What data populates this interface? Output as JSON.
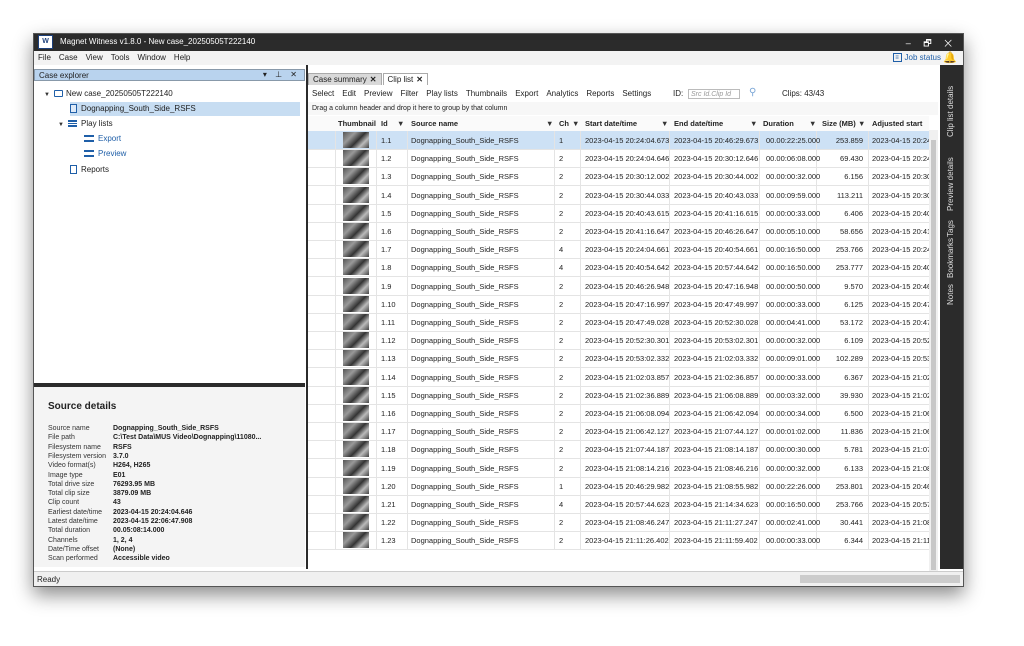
{
  "window": {
    "title": "Magnet Witness v1.8.0 - New case_20250505T222140",
    "logo": "W",
    "controls": "– 🗗 ✕"
  },
  "menu": [
    "File",
    "Case",
    "View",
    "Tools",
    "Window",
    "Help"
  ],
  "job_status": "Job status",
  "left_pane": {
    "title": "Case explorer",
    "controls": "▾ ⊥ ✕",
    "tree": {
      "case": "New case_20250505T222140",
      "source": "Dognapping_South_Side_RSFS",
      "play_lists": "Play lists",
      "export": "Export",
      "preview": "Preview",
      "reports": "Reports"
    }
  },
  "source_details": {
    "title": "Source details",
    "rows": [
      {
        "k": "Source name",
        "v": "Dognapping_South_Side_RSFS"
      },
      {
        "k": "File path",
        "v": "C:\\Test Data\\MUS Video\\Dognapping\\11080..."
      },
      {
        "k": "Filesystem name",
        "v": "RSFS"
      },
      {
        "k": "Filesystem version",
        "v": "3.7.0"
      },
      {
        "k": "Video format(s)",
        "v": "H264, H265"
      },
      {
        "k": "Image type",
        "v": "E01"
      },
      {
        "k": "Total drive size",
        "v": "76293.95 MB"
      },
      {
        "k": "Total clip size",
        "v": "3879.09 MB"
      },
      {
        "k": "Clip count",
        "v": "43"
      },
      {
        "k": "Earliest date/time",
        "v": "2023-04-15 20:24:04.646"
      },
      {
        "k": "Latest date/time",
        "v": "2023-04-15 22:06:47.908"
      },
      {
        "k": "Total duration",
        "v": "00.05:08:14.000"
      },
      {
        "k": "Channels",
        "v": "1, 2, 4"
      },
      {
        "k": "Date/Time offset",
        "v": "(None)"
      },
      {
        "k": "Scan performed",
        "v": "Accessible video"
      }
    ]
  },
  "tabs": [
    {
      "label": "Case summary"
    },
    {
      "label": "Clip list"
    }
  ],
  "toolbar": [
    "Select",
    "Edit",
    "Preview",
    "Filter",
    "Play lists",
    "Thumbnails",
    "Export",
    "Analytics",
    "Reports",
    "Settings"
  ],
  "id_filter": {
    "label": "ID:",
    "placeholder": "Src Id.Clip Id"
  },
  "clips_count": "Clips: 43/43",
  "group_hint": "Drag a column header and drop it here to group by that column",
  "columns": [
    "Thumbnail",
    "Id",
    "Source name",
    "Ch",
    "Start date/time",
    "End date/time",
    "Duration",
    "Size (MB)",
    "Adjusted start"
  ],
  "rows": [
    {
      "id": "1.1",
      "src": "Dognapping_South_Side_RSFS",
      "ch": "1",
      "start": "2023-04-15 20:24:04.673",
      "end": "2023-04-15 20:46:29.673",
      "dur": "00.00:22:25.000",
      "size": "253.859",
      "adj": "2023-04-15 20:24"
    },
    {
      "id": "1.2",
      "src": "Dognapping_South_Side_RSFS",
      "ch": "2",
      "start": "2023-04-15 20:24:04.646",
      "end": "2023-04-15 20:30:12.646",
      "dur": "00.00:06:08.000",
      "size": "69.430",
      "adj": "2023-04-15 20:24"
    },
    {
      "id": "1.3",
      "src": "Dognapping_South_Side_RSFS",
      "ch": "2",
      "start": "2023-04-15 20:30:12.002",
      "end": "2023-04-15 20:30:44.002",
      "dur": "00.00:00:32.000",
      "size": "6.156",
      "adj": "2023-04-15 20:30"
    },
    {
      "id": "1.4",
      "src": "Dognapping_South_Side_RSFS",
      "ch": "2",
      "start": "2023-04-15 20:30:44.033",
      "end": "2023-04-15 20:40:43.033",
      "dur": "00.00:09:59.000",
      "size": "113.211",
      "adj": "2023-04-15 20:30"
    },
    {
      "id": "1.5",
      "src": "Dognapping_South_Side_RSFS",
      "ch": "2",
      "start": "2023-04-15 20:40:43.615",
      "end": "2023-04-15 20:41:16.615",
      "dur": "00.00:00:33.000",
      "size": "6.406",
      "adj": "2023-04-15 20:40"
    },
    {
      "id": "1.6",
      "src": "Dognapping_South_Side_RSFS",
      "ch": "2",
      "start": "2023-04-15 20:41:16.647",
      "end": "2023-04-15 20:46:26.647",
      "dur": "00.00:05:10.000",
      "size": "58.656",
      "adj": "2023-04-15 20:41"
    },
    {
      "id": "1.7",
      "src": "Dognapping_South_Side_RSFS",
      "ch": "4",
      "start": "2023-04-15 20:24:04.661",
      "end": "2023-04-15 20:40:54.661",
      "dur": "00.00:16:50.000",
      "size": "253.766",
      "adj": "2023-04-15 20:24"
    },
    {
      "id": "1.8",
      "src": "Dognapping_South_Side_RSFS",
      "ch": "4",
      "start": "2023-04-15 20:40:54.642",
      "end": "2023-04-15 20:57:44.642",
      "dur": "00.00:16:50.000",
      "size": "253.777",
      "adj": "2023-04-15 20:40"
    },
    {
      "id": "1.9",
      "src": "Dognapping_South_Side_RSFS",
      "ch": "2",
      "start": "2023-04-15 20:46:26.948",
      "end": "2023-04-15 20:47:16.948",
      "dur": "00.00:00:50.000",
      "size": "9.570",
      "adj": "2023-04-15 20:46"
    },
    {
      "id": "1.10",
      "src": "Dognapping_South_Side_RSFS",
      "ch": "2",
      "start": "2023-04-15 20:47:16.997",
      "end": "2023-04-15 20:47:49.997",
      "dur": "00.00:00:33.000",
      "size": "6.125",
      "adj": "2023-04-15 20:47"
    },
    {
      "id": "1.11",
      "src": "Dognapping_South_Side_RSFS",
      "ch": "2",
      "start": "2023-04-15 20:47:49.028",
      "end": "2023-04-15 20:52:30.028",
      "dur": "00.00:04:41.000",
      "size": "53.172",
      "adj": "2023-04-15 20:47"
    },
    {
      "id": "1.12",
      "src": "Dognapping_South_Side_RSFS",
      "ch": "2",
      "start": "2023-04-15 20:52:30.301",
      "end": "2023-04-15 20:53:02.301",
      "dur": "00.00:00:32.000",
      "size": "6.109",
      "adj": "2023-04-15 20:52"
    },
    {
      "id": "1.13",
      "src": "Dognapping_South_Side_RSFS",
      "ch": "2",
      "start": "2023-04-15 20:53:02.332",
      "end": "2023-04-15 21:02:03.332",
      "dur": "00.00:09:01.000",
      "size": "102.289",
      "adj": "2023-04-15 20:53"
    },
    {
      "id": "1.14",
      "src": "Dognapping_South_Side_RSFS",
      "ch": "2",
      "start": "2023-04-15 21:02:03.857",
      "end": "2023-04-15 21:02:36.857",
      "dur": "00.00:00:33.000",
      "size": "6.367",
      "adj": "2023-04-15 21:02"
    },
    {
      "id": "1.15",
      "src": "Dognapping_South_Side_RSFS",
      "ch": "2",
      "start": "2023-04-15 21:02:36.889",
      "end": "2023-04-15 21:06:08.889",
      "dur": "00.00:03:32.000",
      "size": "39.930",
      "adj": "2023-04-15 21:02"
    },
    {
      "id": "1.16",
      "src": "Dognapping_South_Side_RSFS",
      "ch": "2",
      "start": "2023-04-15 21:06:08.094",
      "end": "2023-04-15 21:06:42.094",
      "dur": "00.00:00:34.000",
      "size": "6.500",
      "adj": "2023-04-15 21:06"
    },
    {
      "id": "1.17",
      "src": "Dognapping_South_Side_RSFS",
      "ch": "2",
      "start": "2023-04-15 21:06:42.127",
      "end": "2023-04-15 21:07:44.127",
      "dur": "00.00:01:02.000",
      "size": "11.836",
      "adj": "2023-04-15 21:06"
    },
    {
      "id": "1.18",
      "src": "Dognapping_South_Side_RSFS",
      "ch": "2",
      "start": "2023-04-15 21:07:44.187",
      "end": "2023-04-15 21:08:14.187",
      "dur": "00.00:00:30.000",
      "size": "5.781",
      "adj": "2023-04-15 21:07"
    },
    {
      "id": "1.19",
      "src": "Dognapping_South_Side_RSFS",
      "ch": "2",
      "start": "2023-04-15 21:08:14.216",
      "end": "2023-04-15 21:08:46.216",
      "dur": "00.00:00:32.000",
      "size": "6.133",
      "adj": "2023-04-15 21:08"
    },
    {
      "id": "1.20",
      "src": "Dognapping_South_Side_RSFS",
      "ch": "1",
      "start": "2023-04-15 20:46:29.982",
      "end": "2023-04-15 21:08:55.982",
      "dur": "00.00:22:26.000",
      "size": "253.801",
      "adj": "2023-04-15 20:46"
    },
    {
      "id": "1.21",
      "src": "Dognapping_South_Side_RSFS",
      "ch": "4",
      "start": "2023-04-15 20:57:44.623",
      "end": "2023-04-15 21:14:34.623",
      "dur": "00.00:16:50.000",
      "size": "253.766",
      "adj": "2023-04-15 20:57"
    },
    {
      "id": "1.22",
      "src": "Dognapping_South_Side_RSFS",
      "ch": "2",
      "start": "2023-04-15 21:08:46.247",
      "end": "2023-04-15 21:11:27.247",
      "dur": "00.00:02:41.000",
      "size": "30.441",
      "adj": "2023-04-15 21:08"
    },
    {
      "id": "1.23",
      "src": "Dognapping_South_Side_RSFS",
      "ch": "2",
      "start": "2023-04-15 21:11:26.402",
      "end": "2023-04-15 21:11:59.402",
      "dur": "00.00:00:33.000",
      "size": "6.344",
      "adj": "2023-04-15 21:11"
    }
  ],
  "right_tabs": [
    "Clip list details",
    "Preview details",
    "Tags",
    "Bookmarks",
    "Notes"
  ],
  "status": "Ready"
}
